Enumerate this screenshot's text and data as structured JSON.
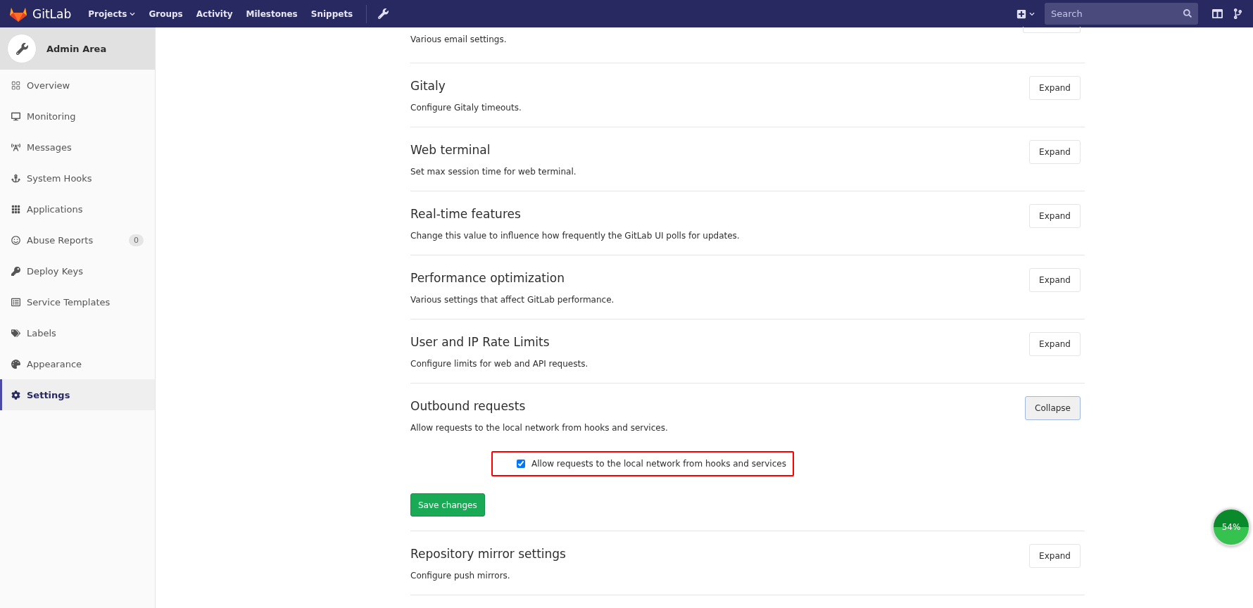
{
  "header": {
    "brand": "GitLab",
    "nav": [
      {
        "label": "Projects"
      },
      {
        "label": "Groups"
      },
      {
        "label": "Activity"
      },
      {
        "label": "Milestones"
      },
      {
        "label": "Snippets"
      }
    ],
    "search": {
      "placeholder": "Search"
    }
  },
  "sidebar": {
    "title": "Admin Area",
    "items": [
      {
        "label": "Overview",
        "selected": false
      },
      {
        "label": "Monitoring",
        "selected": false
      },
      {
        "label": "Messages",
        "selected": false
      },
      {
        "label": "System Hooks",
        "selected": false
      },
      {
        "label": "Applications",
        "selected": false
      },
      {
        "label": "Abuse Reports",
        "selected": false,
        "badge": "0"
      },
      {
        "label": "Deploy Keys",
        "selected": false
      },
      {
        "label": "Service Templates",
        "selected": false
      },
      {
        "label": "Labels",
        "selected": false
      },
      {
        "label": "Appearance",
        "selected": false
      },
      {
        "label": "Settings",
        "selected": true
      }
    ]
  },
  "sections": [
    {
      "description": "Various email settings."
    },
    {
      "title": "Gitaly",
      "description": "Configure Gitaly timeouts.",
      "button": "Expand",
      "expanded": false
    },
    {
      "title": "Web terminal",
      "description": "Set max session time for web terminal.",
      "button": "Expand",
      "expanded": false
    },
    {
      "title": "Real-time features",
      "description": "Change this value to influence how frequently the GitLab UI polls for updates.",
      "button": "Expand",
      "expanded": false
    },
    {
      "title": "Performance optimization",
      "description": "Various settings that affect GitLab performance.",
      "button": "Expand",
      "expanded": false
    },
    {
      "title": "User and IP Rate Limits",
      "description": "Configure limits for web and API requests.",
      "button": "Expand",
      "expanded": false
    },
    {
      "title": "Outbound requests",
      "description": "Allow requests to the local network from hooks and services.",
      "button": "Collapse",
      "expanded": true,
      "checkbox": {
        "label": "Allow requests to the local network from hooks and services",
        "checked": true
      },
      "save": "Save changes"
    },
    {
      "title": "Repository mirror settings",
      "description": "Configure push mirrors.",
      "button": "Expand",
      "expanded": false
    }
  ],
  "speed_ball": "54%"
}
